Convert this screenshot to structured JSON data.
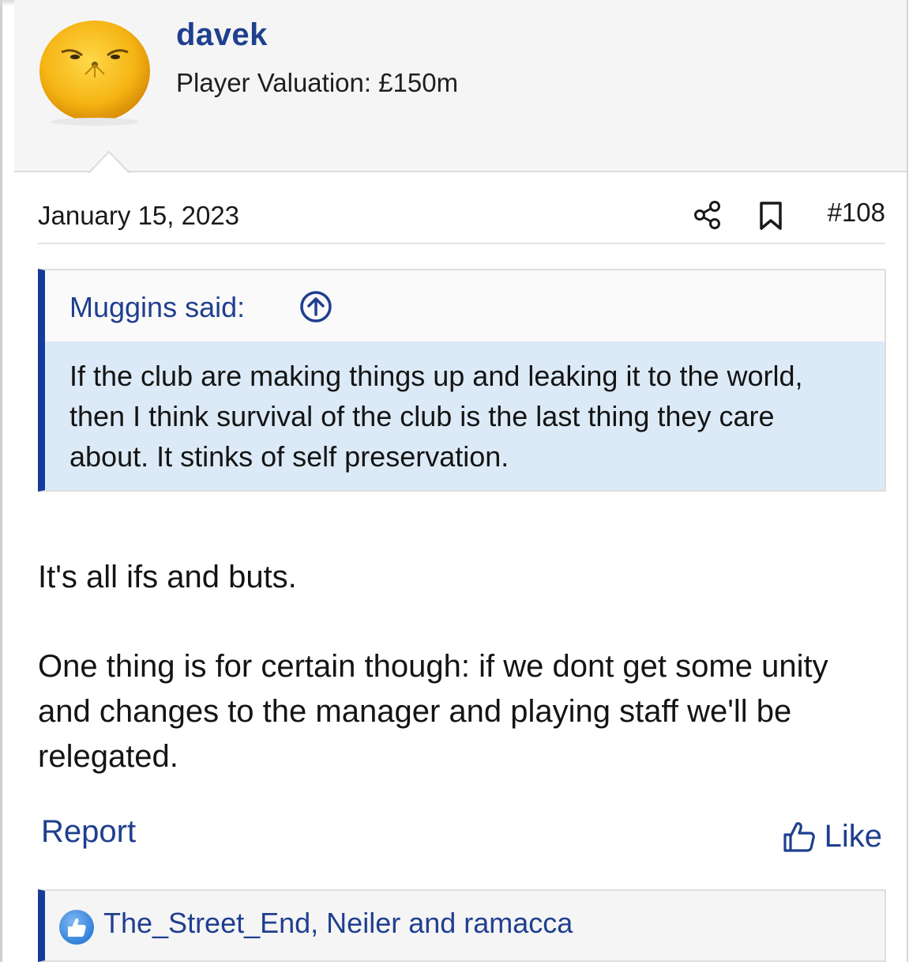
{
  "user": {
    "name": "davek",
    "title": "Player Valuation: £150m",
    "avatar_icon": "orange-face-avatar"
  },
  "post": {
    "date": "January 15, 2023",
    "number": "#108",
    "share_icon": "share-icon",
    "bookmark_icon": "bookmark-icon"
  },
  "quote": {
    "author_label": "Muggins said:",
    "jump_icon": "arrow-circle-up-icon",
    "text": "If the club are making things up and leaking it to the world, then I think survival of the club is the last thing they care about. It stinks of self preservation."
  },
  "message": {
    "paragraphs": [
      "It's all ifs and buts.",
      "One thing is for certain though: if we dont get some unity and changes to the manager and playing staff we'll be relegated."
    ]
  },
  "actions": {
    "report_label": "Report",
    "like_label": "Like",
    "like_icon": "thumbs-up-icon"
  },
  "reactions": {
    "icon": "like-reaction-icon",
    "text": "The_Street_End, Neiler and ramacca"
  },
  "colors": {
    "link": "#1f3f8f",
    "accent_bar": "#173b9a",
    "quote_bg": "#dceaf7",
    "header_bg": "#f5f5f5"
  }
}
